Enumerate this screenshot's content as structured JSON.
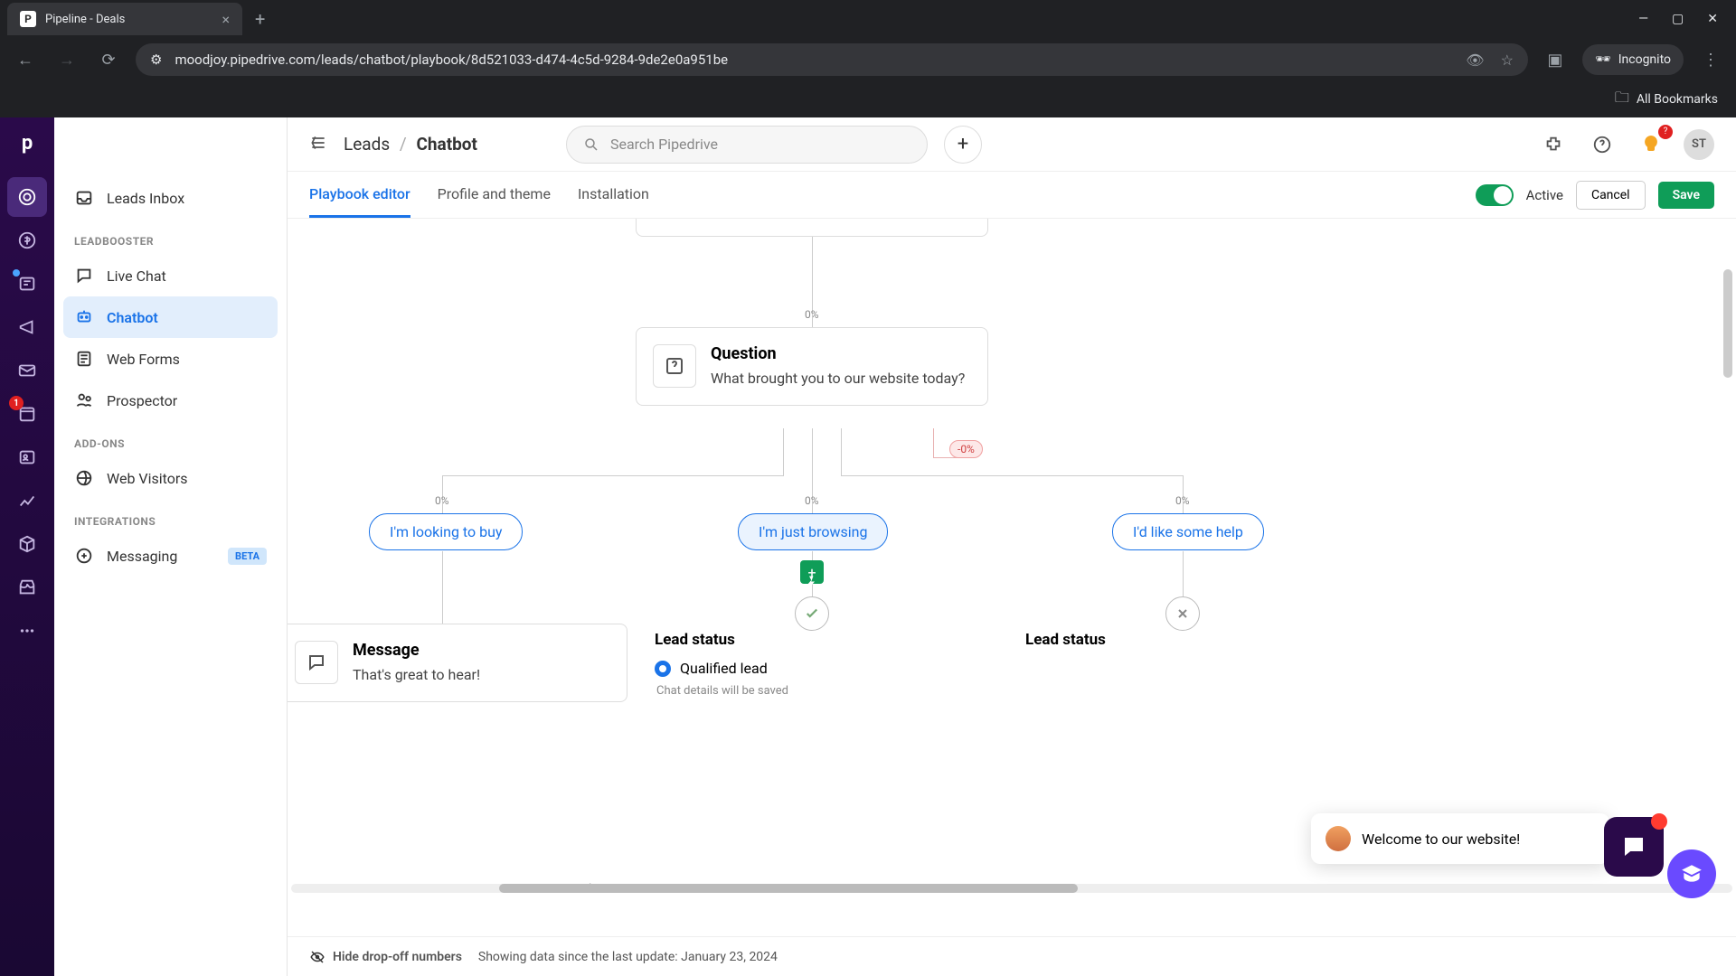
{
  "browser": {
    "tab_title": "Pipeline - Deals",
    "url": "moodjoy.pipedrive.com/leads/chatbot/playbook/8d521033-d474-4c5d-9284-9de2e0a951be",
    "incognito": "Incognito",
    "all_bookmarks": "All Bookmarks"
  },
  "rail": {
    "notification_badge": "1"
  },
  "breadcrumb": {
    "parent": "Leads",
    "current": "Chatbot"
  },
  "search": {
    "placeholder": "Search Pipedrive"
  },
  "topbar": {
    "avatar_initials": "ST",
    "bulb_count": "?"
  },
  "sidebar": {
    "inbox": "Leads Inbox",
    "h1": "LEADBOOSTER",
    "live_chat": "Live Chat",
    "chatbot": "Chatbot",
    "web_forms": "Web Forms",
    "prospector": "Prospector",
    "h2": "ADD-ONS",
    "web_visitors": "Web Visitors",
    "h3": "INTEGRATIONS",
    "messaging": "Messaging",
    "beta": "BETA"
  },
  "tabs": {
    "editor": "Playbook editor",
    "profile": "Profile and theme",
    "install": "Installation",
    "active": "Active",
    "cancel": "Cancel",
    "save": "Save"
  },
  "canvas": {
    "top_pct": "0%",
    "question_title": "Question",
    "question_body": "What brought you to our website today?",
    "neg_pct": "-0%",
    "opt1_pct": "0%",
    "opt1": "I'm looking to buy",
    "opt2_pct": "0%",
    "opt2": "I'm just browsing",
    "opt3_pct": "0%",
    "opt3": "I'd like some help",
    "msg_title": "Message",
    "msg_body": "That's great to hear!",
    "lead_title": "Lead status",
    "lead_qualified": "Qualified lead",
    "lead_sub": "Chat details will be saved",
    "lead_title2": "Lead status"
  },
  "footer": {
    "hide": "Hide drop-off numbers",
    "info": "Showing data since the last update: January 23, 2024"
  },
  "chat": {
    "welcome": "Welcome to our website!"
  }
}
